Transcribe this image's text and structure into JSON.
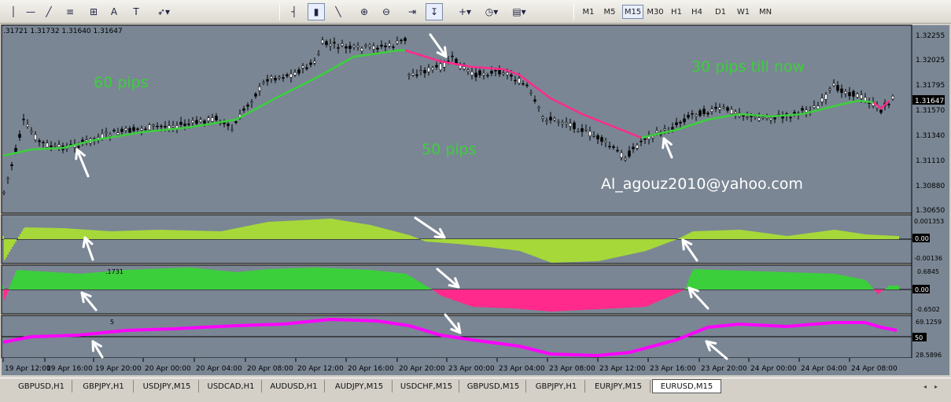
{
  "toolbar": {
    "timeframes": [
      "M1",
      "M5",
      "M15",
      "M30",
      "H1",
      "H4",
      "D1",
      "W1",
      "MN"
    ],
    "active_timeframe": "M15",
    "tools": [
      "cursor-icon",
      "horizontal-line-icon",
      "trendline-icon",
      "fibonacci-icon",
      "grid-icon",
      "text-A-icon",
      "text-label-icon",
      "arrows-icon",
      "bar-chart-icon",
      "candlestick-icon",
      "line-chart-icon",
      "zoom-in-icon",
      "zoom-out-icon",
      "chart-shift-icon",
      "autoscroll-icon",
      "indicators-icon",
      "periods-icon",
      "templates-icon"
    ]
  },
  "main_chart": {
    "ohlc_label": ".31721 1.31732 1.31640 1.31647",
    "price_labels": [
      "1.32255",
      "1.32025",
      "1.31795",
      "1.31647",
      "1.31570",
      "1.31340",
      "1.31110",
      "1.30880",
      "1.30650"
    ],
    "current_price": "1.31647",
    "annotations": {
      "pips_60": "60 pips",
      "pips_50": "50 pips",
      "pips_30": "30 pips till now",
      "email": "Al_agouz2010@yahoo.com"
    }
  },
  "sub1": {
    "labels": [
      "0.001353",
      "0.00",
      "-0.00136"
    ]
  },
  "sub2": {
    "header": ".1731",
    "labels": [
      "0.6845",
      "0.00",
      "-0.6502"
    ]
  },
  "sub3": {
    "header": "5",
    "labels": [
      "69.1259",
      "50",
      "28.5896"
    ]
  },
  "time_axis": [
    "19 Apr 12:00",
    "19 Apr 16:00",
    "19 Apr 20:00",
    "20 Apr 00:00",
    "20 Apr 04:00",
    "20 Apr 08:00",
    "20 Apr 12:00",
    "20 Apr 16:00",
    "20 Apr 20:00",
    "23 Apr 00:00",
    "23 Apr 04:00",
    "23 Apr 08:00",
    "23 Apr 12:00",
    "23 Apr 16:00",
    "23 Apr 20:00",
    "24 Apr 00:00",
    "24 Apr 04:00",
    "24 Apr 08:00"
  ],
  "tabs": [
    "GBPUSD,H1",
    "GBPJPY,H1",
    "USDJPY,M15",
    "USDCAD,H1",
    "AUDUSD,H1",
    "AUDJPY,M15",
    "USDCHF,M15",
    "GBPUSD,M15",
    "GBPJPY,H1",
    "EURJPY,M15",
    "EURUSD,M15"
  ],
  "active_tab": "EURUSD,M15",
  "colors": {
    "chart_bg": "#7a8694",
    "ma_up": "#3ccf3c",
    "ma_down": "#ff2a8c",
    "hist_lime": "#a6d83a",
    "hist_green": "#3ccf3c",
    "hist_pink": "#ff2a8c",
    "magenta_line": "#ff00ff",
    "annotation_text": "#3ccf3c",
    "email_text": "#ffffff"
  }
}
